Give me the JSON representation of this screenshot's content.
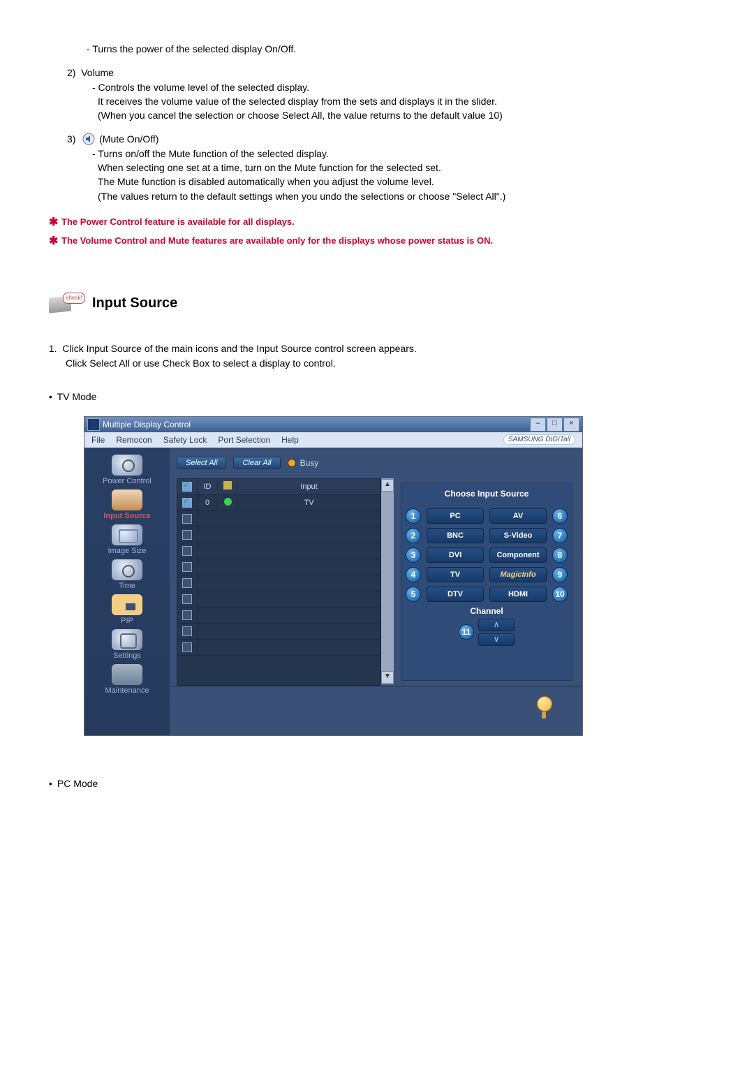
{
  "item1": {
    "line1": "- Turns the power of the selected display On/Off."
  },
  "item2": {
    "num": "2)",
    "title": "Volume",
    "l1": "- Controls the volume level of the selected display.",
    "l2": "It receives the volume value of the selected display from the sets and displays it in the slider.",
    "l3": "(When you cancel the selection or choose Select All, the value returns to the default value 10)"
  },
  "item3": {
    "num": "3)",
    "title": "(Mute On/Off)",
    "l1": "- Turns on/off the Mute function of the selected display.",
    "l2": "When selecting one set at a time, turn on the Mute function for the selected set.",
    "l3": "The Mute function is disabled automatically when you adjust the volume level.",
    "l4": "(The values return to the default settings when you undo the selections or choose \"Select All\".)"
  },
  "star1": "The Power Control feature is available for all displays.",
  "star2": "The Volume Control and Mute features are available only for the displays whose power status is ON.",
  "section_title": "Input Source",
  "section_tag": "check!",
  "intro": {
    "num": "1.",
    "l1": "Click Input Source of the main icons and the Input Source control screen appears.",
    "l2": "Click Select All or use Check Box to select a display to control."
  },
  "tv_mode": "TV Mode",
  "pc_mode": "PC Mode",
  "mdc": {
    "title": "Multiple Display Control",
    "menu": {
      "file": "File",
      "remocon": "Remocon",
      "safety": "Safety Lock",
      "port": "Port Selection",
      "help": "Help"
    },
    "brand": "SAMSUNG DIGITall",
    "toolbar": {
      "select_all": "Select All",
      "clear_all": "Clear All",
      "busy": "Busy"
    },
    "nav": [
      {
        "label": "Power Control"
      },
      {
        "label": "Input Source"
      },
      {
        "label": "Image Size"
      },
      {
        "label": "Time"
      },
      {
        "label": "PIP"
      },
      {
        "label": "Settings"
      },
      {
        "label": "Maintenance"
      }
    ],
    "grid": {
      "h_id": "ID",
      "h_input": "Input",
      "rows": [
        {
          "checked": true,
          "id": "0",
          "status": "green",
          "input": "TV"
        }
      ],
      "blank_rows": 9
    },
    "right": {
      "title": "Choose Input Source",
      "sources_left": [
        {
          "n": "1",
          "label": "PC"
        },
        {
          "n": "2",
          "label": "BNC"
        },
        {
          "n": "3",
          "label": "DVI"
        },
        {
          "n": "4",
          "label": "TV"
        },
        {
          "n": "5",
          "label": "DTV"
        }
      ],
      "sources_right": [
        {
          "n": "6",
          "label": "AV"
        },
        {
          "n": "7",
          "label": "S-Video"
        },
        {
          "n": "8",
          "label": "Component"
        },
        {
          "n": "9",
          "label": "MagicInfo"
        },
        {
          "n": "10",
          "label": "HDMI"
        }
      ],
      "channel_label": "Channel",
      "channel_badge": "11"
    }
  }
}
